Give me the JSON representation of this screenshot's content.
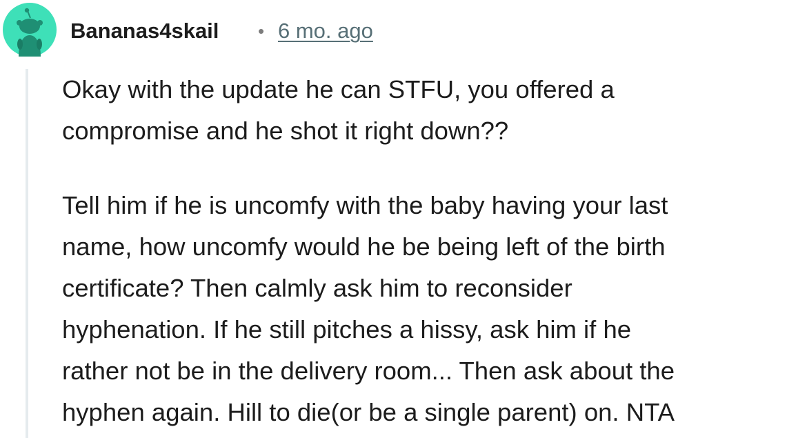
{
  "comment": {
    "author": "Bananas4skail",
    "separator": "•",
    "timestamp": "6 mo. ago",
    "avatar_icon": "snoo-avatar-icon",
    "colors": {
      "avatar_bg": "#3ee0b8",
      "timestamp": "#576f76",
      "thread_line": "#e5ebee"
    },
    "paragraphs": [
      {
        "lines": [
          "Okay with the update he can STFU, you offered a",
          "compromise and he shot it right down??"
        ]
      },
      {
        "lines": [
          "Tell him if he is uncomfy with the baby having your last",
          "name, how uncomfy would he be being left of the birth",
          "certificate? Then calmly ask him to reconsider",
          "hyphenation. If he still pitches a hissy, ask him if he",
          "rather not be in the delivery room... Then ask about the",
          "hyphen again. Hill to die(or be a single parent) on. NTA"
        ]
      }
    ]
  }
}
